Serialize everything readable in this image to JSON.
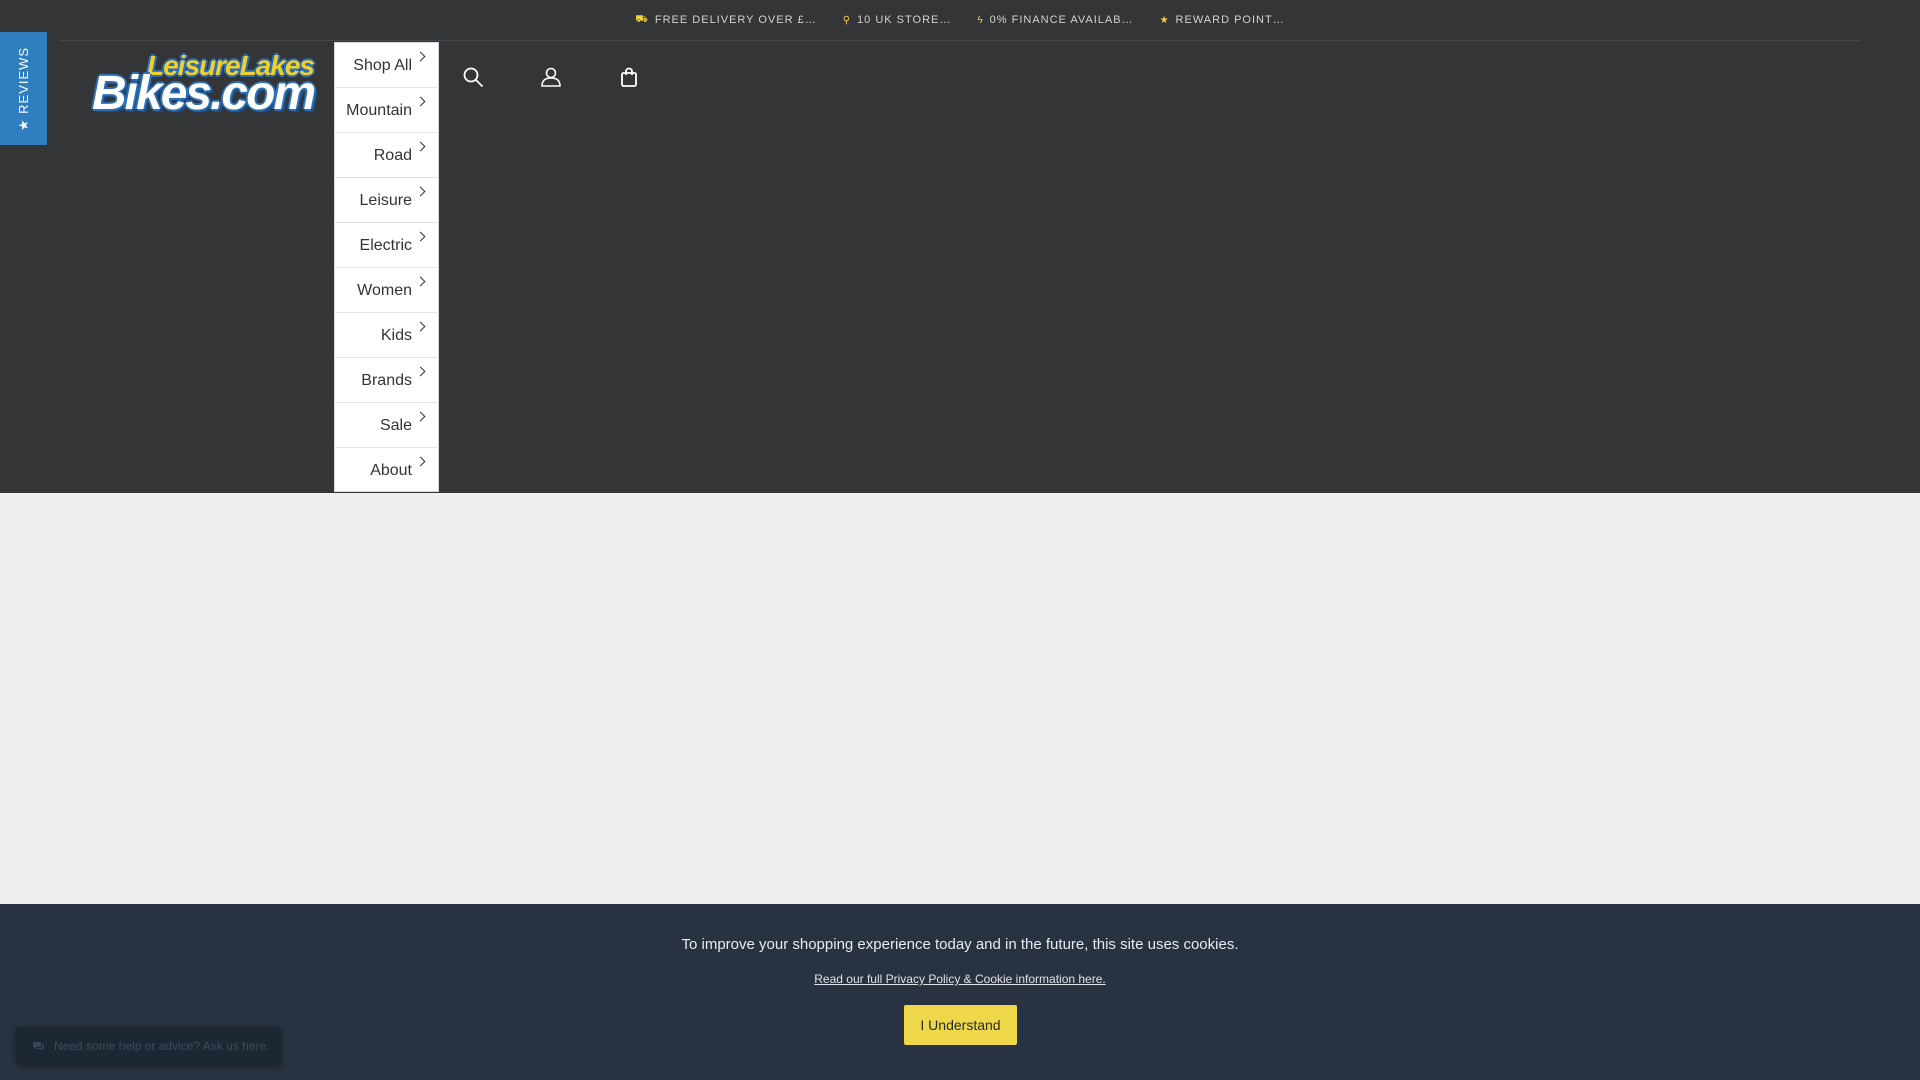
{
  "topbar": {
    "items": [
      {
        "icon": "truck-icon",
        "label": "FREE DELIVERY OVER £…"
      },
      {
        "icon": "location-pin-icon",
        "label": "10 UK STORE…"
      },
      {
        "icon": "lightning-icon",
        "label": "0% FINANCE AVAILAB…"
      },
      {
        "icon": "star-icon",
        "label": "REWARD POINT…"
      }
    ]
  },
  "reviews_tab": {
    "label": "★ REVIEWS"
  },
  "logo": {
    "line1": "LeisureLakes",
    "line2": "Bikes.com"
  },
  "nav": {
    "items": [
      {
        "label": "Shop All"
      },
      {
        "label": "Mountain"
      },
      {
        "label": "Road"
      },
      {
        "label": "Leisure"
      },
      {
        "label": "Electric"
      },
      {
        "label": "Women"
      },
      {
        "label": "Kids"
      },
      {
        "label": "Brands"
      },
      {
        "label": "Sale"
      },
      {
        "label": "About"
      }
    ]
  },
  "header_icons": [
    "search-icon",
    "account-icon",
    "shopping-bag-icon"
  ],
  "cookie": {
    "message": "To improve your shopping experience today and in the future, this site uses cookies.",
    "link": "Read our full Privacy Policy & Cookie information here.",
    "button": "I Understand"
  },
  "chat": {
    "placeholder": "Need some help or advice? Ask us here."
  },
  "colors": {
    "header_bg": "#343537",
    "page_bg": "#efefef",
    "accent_yellow": "#eed84a",
    "reviews_blue": "#2f7fc0",
    "cookie_bg": "#293240"
  }
}
